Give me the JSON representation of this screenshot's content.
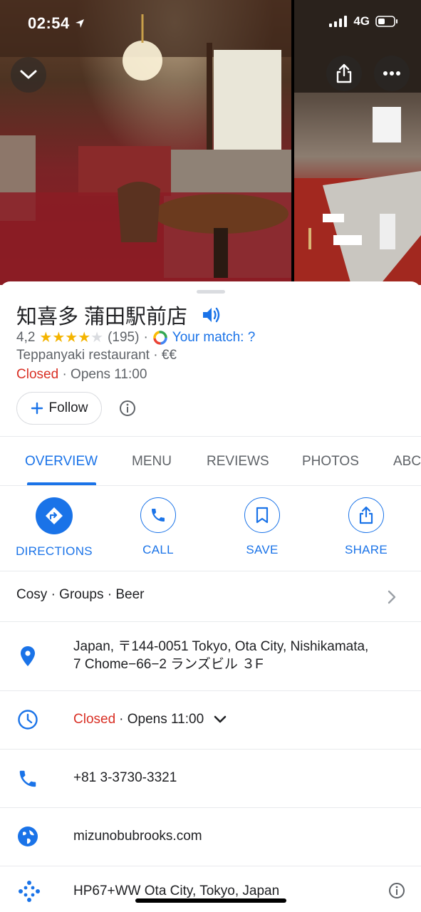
{
  "status_bar": {
    "time": "02:54",
    "network": "4G"
  },
  "header": {
    "collapse_icon": "chevron-down-icon",
    "share_icon": "share-icon",
    "more_icon": "more-icon"
  },
  "place": {
    "name": "知喜多 蒲田駅前店",
    "rating": "4,2",
    "rating_value": 4.2,
    "review_count": "(195)",
    "match_label": "Your match: ?",
    "category": "Teppanyaki restaurant · €€",
    "status": "Closed",
    "opens": "· Opens 11:00",
    "follow_label": "Follow"
  },
  "tabs": [
    "OVERVIEW",
    "MENU",
    "REVIEWS",
    "PHOTOS",
    "ABC"
  ],
  "actions": {
    "directions": "DIRECTIONS",
    "call": "CALL",
    "save": "SAVE",
    "share": "SHARE"
  },
  "attributes": "Cosy · Groups · Beer",
  "address": {
    "line1": "Japan, 〒144-0051 Tokyo, Ota City, Nishikamata,",
    "line2": "7 Chome−66−2 ランズビル ３F"
  },
  "hours": {
    "status": "Closed",
    "opens": "· Opens 11:00"
  },
  "phone": "+81 3-3730-3321",
  "website": "mizunobubrooks.com",
  "plus_code": "HP67+WW Ota City, Tokyo, Japan",
  "colors": {
    "accent": "#1a73e8",
    "closed": "#d93025",
    "star": "#f4b400"
  }
}
